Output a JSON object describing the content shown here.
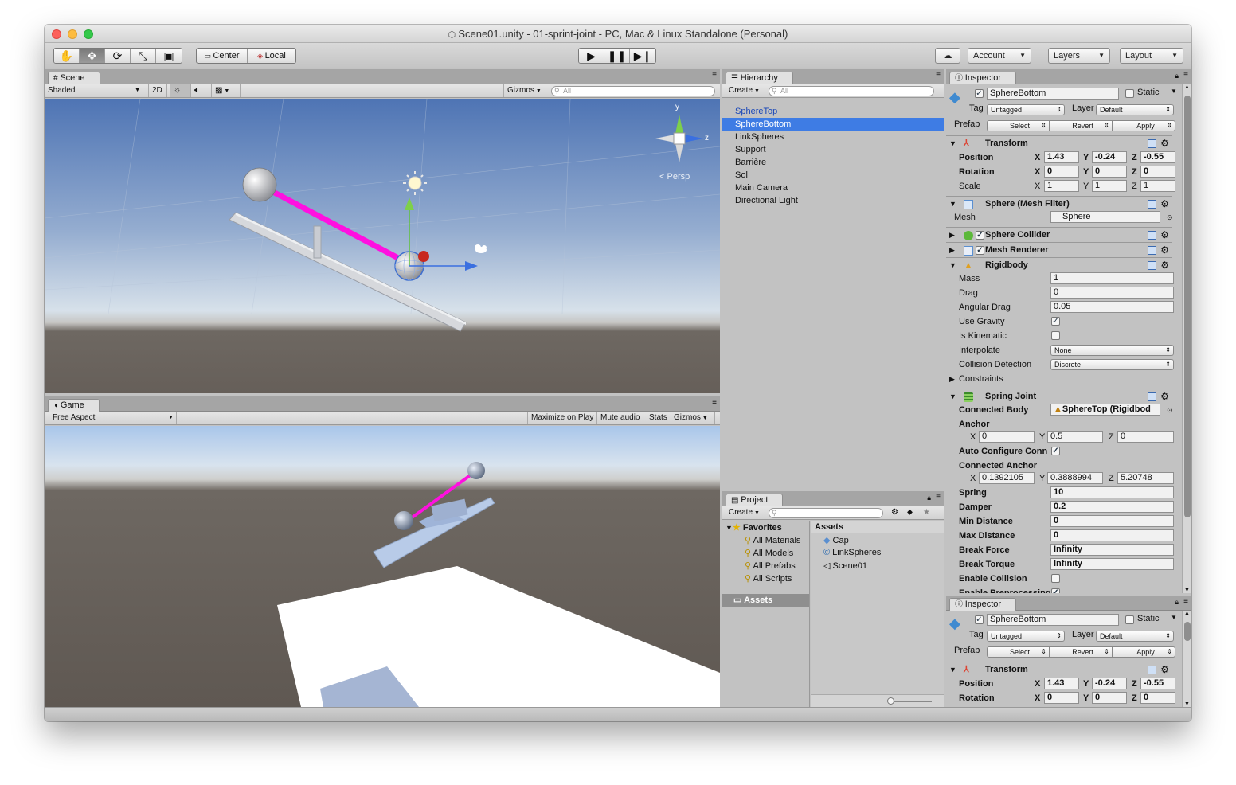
{
  "window": {
    "title": "Scene01.unity - 01-sprint-joint - PC, Mac & Linux Standalone (Personal)"
  },
  "toolbar": {
    "tools": [
      "hand-icon",
      "move-icon",
      "rotate-icon",
      "scale-icon",
      "rect-tool-icon"
    ],
    "pivot": "Center",
    "space": "Local",
    "account": "Account",
    "layers": "Layers",
    "layout": "Layout"
  },
  "scene": {
    "tab": "Scene",
    "shading": "Shaded",
    "mode2d": "2D",
    "gizmos": "Gizmos",
    "search": "All",
    "persp": "Persp",
    "axis_y": "y",
    "axis_z": "z"
  },
  "game": {
    "tab": "Game",
    "aspect": "Free Aspect",
    "maximize": "Maximize on Play",
    "mute": "Mute audio",
    "stats": "Stats",
    "gizmos": "Gizmos"
  },
  "hierarchy": {
    "tab": "Hierarchy",
    "create": "Create",
    "search": "All",
    "items": [
      "SphereTop",
      "SphereBottom",
      "LinkSpheres",
      "Support",
      "Barrière",
      "Sol",
      "Main Camera",
      "Directional Light"
    ],
    "selected": "SphereBottom"
  },
  "project": {
    "tab": "Project",
    "create": "Create",
    "favorites": "Favorites",
    "fav_items": [
      "All Materials",
      "All Models",
      "All Prefabs",
      "All Scripts"
    ],
    "assets_folder": "Assets",
    "assets_header": "Assets",
    "assets": [
      "Cap",
      "LinkSpheres",
      "Scene01"
    ]
  },
  "inspector": {
    "tab": "Inspector",
    "name": "SphereBottom",
    "static": "Static",
    "tag_label": "Tag",
    "tag": "Untagged",
    "layer_label": "Layer",
    "layer": "Default",
    "prefab": "Prefab",
    "select": "Select",
    "revert": "Revert",
    "apply": "Apply",
    "transform": {
      "title": "Transform",
      "position": "Position",
      "rotation": "Rotation",
      "scale": "Scale",
      "pos": [
        "1.43",
        "-0.24",
        "-0.55"
      ],
      "rot": [
        "0",
        "0",
        "0"
      ],
      "scl": [
        "1",
        "1",
        "1"
      ]
    },
    "mesh_filter": {
      "title": "Sphere (Mesh Filter)",
      "mesh_label": "Mesh",
      "mesh": "Sphere"
    },
    "sphere_collider": "Sphere Collider",
    "mesh_renderer": "Mesh Renderer",
    "rigidbody": {
      "title": "Rigidbody",
      "mass_l": "Mass",
      "mass": "1",
      "drag_l": "Drag",
      "drag": "0",
      "adrag_l": "Angular Drag",
      "adrag": "0.05",
      "gravity_l": "Use Gravity",
      "kinematic_l": "Is Kinematic",
      "interp_l": "Interpolate",
      "interp": "None",
      "coll_l": "Collision Detection",
      "coll": "Discrete",
      "constraints": "Constraints"
    },
    "spring": {
      "title": "Spring Joint",
      "cbody_l": "Connected Body",
      "cbody": "SphereTop (Rigidbod",
      "anchor_l": "Anchor",
      "anchor": [
        "0",
        "0.5",
        "0"
      ],
      "auto_l": "Auto Configure Conn",
      "canchor_l": "Connected Anchor",
      "canchor": [
        "0.1392105",
        "0.3888994",
        "5.20748"
      ],
      "spring_l": "Spring",
      "spring": "10",
      "damper_l": "Damper",
      "damper": "0.2",
      "min_l": "Min Distance",
      "min": "0",
      "max_l": "Max Distance",
      "max": "0",
      "bforce_l": "Break Force",
      "bforce": "Infinity",
      "btorque_l": "Break Torque",
      "btorque": "Infinity",
      "ecoll_l": "Enable Collision",
      "epre_l": "Enable Preprocessing"
    },
    "axes": [
      "X",
      "Y",
      "Z"
    ]
  },
  "colors": {
    "selection": "#3e7ce4",
    "link": "#ff10e0",
    "sky_top": "#4e74b4",
    "ground": "#6e6862"
  }
}
